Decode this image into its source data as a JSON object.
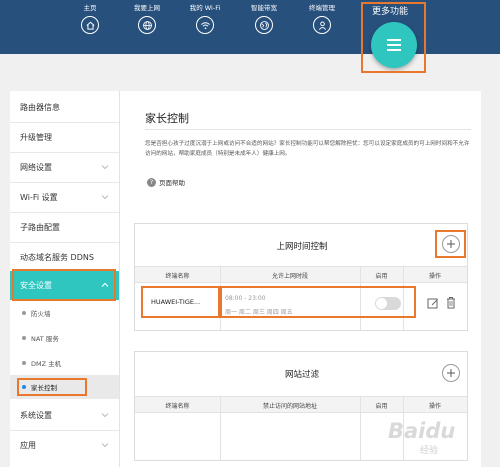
{
  "nav": {
    "items": [
      {
        "label": "主页",
        "icon": "home-icon"
      },
      {
        "label": "我要上网",
        "icon": "globe-icon"
      },
      {
        "label": "我的 Wi-Fi",
        "icon": "wifi-icon"
      },
      {
        "label": "智能带宽",
        "icon": "bandwidth-globe-icon"
      },
      {
        "label": "终端管理",
        "icon": "user-icon"
      }
    ],
    "more_label": "更多功能",
    "more_icon": "menu-icon"
  },
  "sidebar": {
    "items": [
      {
        "label": "路由器信息"
      },
      {
        "label": "升级管理"
      },
      {
        "label": "网络设置"
      },
      {
        "label": "Wi-Fi 设置"
      },
      {
        "label": "子路由配置"
      },
      {
        "label": "动态域名服务 DDNS"
      },
      {
        "label": "安全设置"
      },
      {
        "label": "系统设置"
      },
      {
        "label": "应用"
      }
    ],
    "security_sub": [
      {
        "label": "防火墙"
      },
      {
        "label": "NAT 服务"
      },
      {
        "label": "DMZ 主机"
      },
      {
        "label": "家长控制"
      }
    ]
  },
  "main": {
    "title": "家长控制",
    "description": "您是否担心孩子过度沉溺于上网或访问不合适的网站？家长控制功能可以帮您解除担忧：您可以设定家庭成员的可上网时间和不允许访问的网站，帮助家庭成员（特别是未成年人）健康上网。",
    "help_link": "页面帮助",
    "time_card": {
      "title": "上网时间控制",
      "headers": [
        "终端名称",
        "允许上网时段",
        "启用",
        "操作"
      ],
      "rows": [
        {
          "device": "HUAWEI-TIGE...",
          "time": "08:00 - 23:00",
          "days": "周一 周二 周三 周四 周五",
          "enabled": false
        }
      ]
    },
    "site_card": {
      "title": "网站过滤",
      "headers": [
        "终端名称",
        "禁止访问的网站地址",
        "启用",
        "操作"
      ]
    }
  },
  "watermark": {
    "text": "Baidu",
    "sub": "经验"
  },
  "colors": {
    "nav_bg": "#27507c",
    "accent": "#30c6c0",
    "highlight": "#e8782e"
  }
}
